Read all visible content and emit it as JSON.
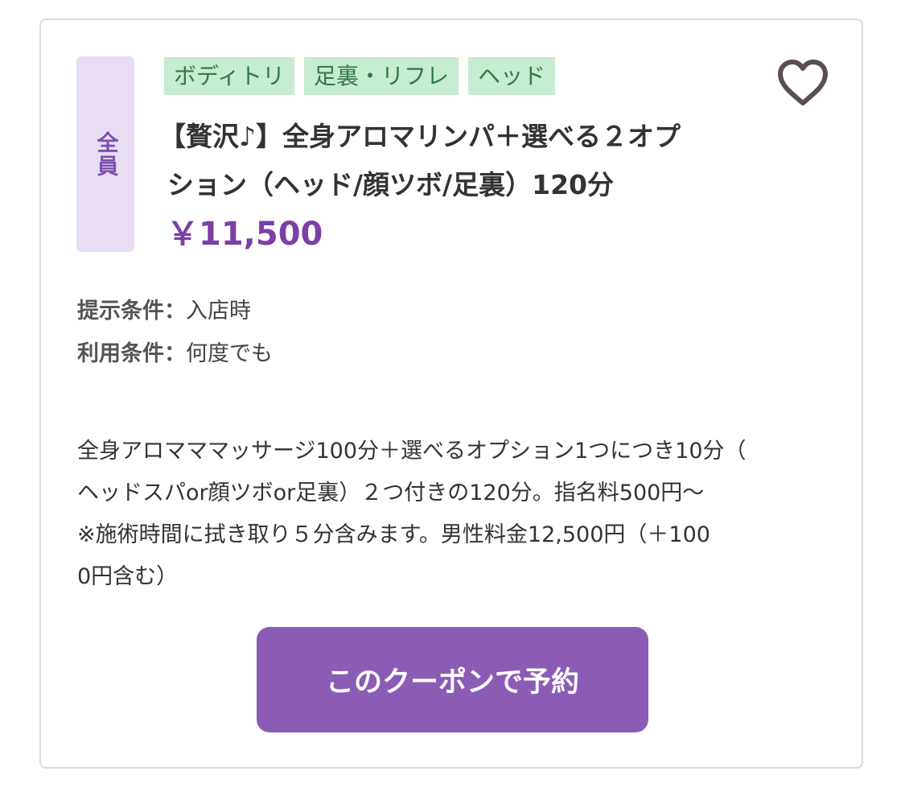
{
  "coupon": {
    "target_badge": "全員",
    "tags": [
      "ボディトリ",
      "足裏・リフレ",
      "ヘッド"
    ],
    "title_lines": [
      "【贅沢♪】全身アロマリンパ＋選べる２オプ",
      "ション（ヘッド/顔ツボ/足裏）120分"
    ],
    "price": "￥11,500",
    "favorite_icon": "heart-outline-icon",
    "conditions": {
      "present_label": "提示条件：",
      "present_value": "入店時",
      "usage_label": "利用条件：",
      "usage_value": "何度でも"
    },
    "description_lines": [
      "全身アロマママッサージ100分＋選べるオプション1つにつき10分（",
      "ヘッドスパor顔ツボor足裏）２つ付きの120分。指名料500円〜",
      "※施術時間に拭き取り５分含みます。男性料金12,500円（＋100",
      "0円含む）"
    ],
    "book_button_label": "このクーポンで予約"
  },
  "colors": {
    "accent": "#8b5cb6",
    "price": "#7b3fa6",
    "tag_bg": "#c6ecd2",
    "tag_text": "#2f7a45",
    "badge_bg": "#e8ddf3"
  }
}
